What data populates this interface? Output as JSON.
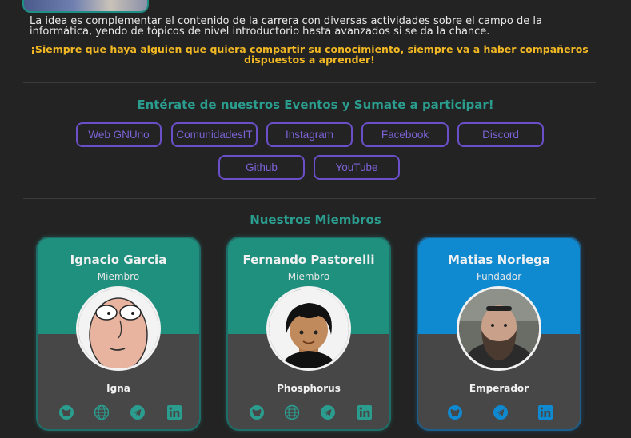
{
  "intro": {
    "text": "La idea es complementar el contenido de la carrera con diversas actividades sobre el campo de la informática, yendo de tópicos de nivel introductorio hasta avanzados si se da la chance.",
    "callout": "¡Siempre que haya alguien que quiera compartir su conocimiento, siempre va a haber compañeros dispuestos a aprender!"
  },
  "events": {
    "title": "Entérate de nuestros Eventos y Sumate a participar!",
    "links": [
      "Web GNUno",
      "ComunidadesIT",
      "Instagram",
      "Facebook",
      "Discord",
      "Github",
      "YouTube"
    ]
  },
  "members": {
    "title": "Nuestros Miembros",
    "cards": [
      {
        "name": "Ignacio Garcia",
        "role": "Miembro",
        "nick": "Igna",
        "socials": [
          "github-icon",
          "globe-icon",
          "telegram-icon",
          "linkedin-icon"
        ]
      },
      {
        "name": "Fernando Pastorelli",
        "role": "Miembro",
        "nick": "Phosphorus",
        "socials": [
          "github-icon",
          "globe-icon",
          "telegram-icon",
          "linkedin-icon"
        ]
      },
      {
        "name": "Matias Noriega",
        "role": "Fundador",
        "nick": "Emperador",
        "socials": [
          "github-icon",
          "telegram-icon",
          "linkedin-icon"
        ]
      }
    ]
  },
  "colors": {
    "background": "#232323",
    "accent_teal": "#2a9d8f",
    "accent_blue": "#0f8ad0",
    "callout_yellow": "#f2b824",
    "button_purple": "#6a4fc8"
  }
}
